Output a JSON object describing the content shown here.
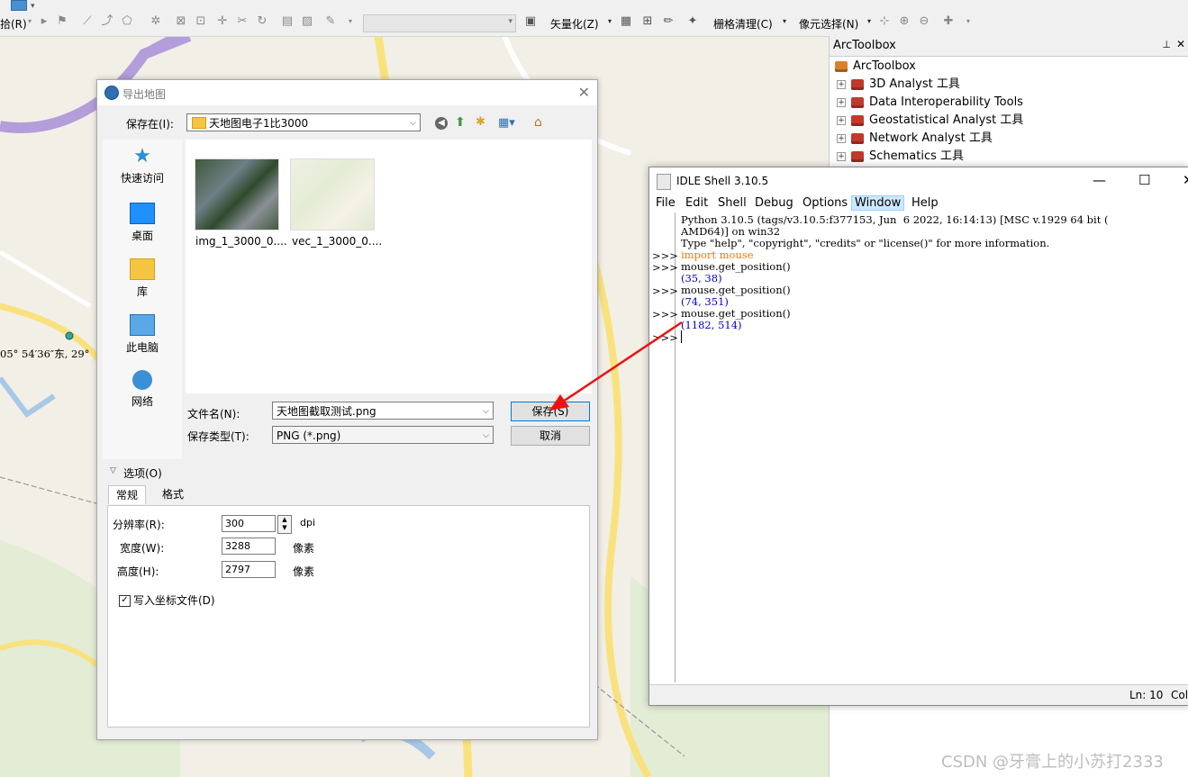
{
  "toolbar": {
    "fragment_left": "拾(R)",
    "vectorize_label": "矢量化(Z)",
    "raster_clean_label": "栅格清理(C)",
    "pixel_select_label": "像元选择(N)"
  },
  "map": {
    "coordinate_text": "05° 54′36″东, 29°"
  },
  "arctoolbox": {
    "title": "ArcToolbox",
    "root": "ArcToolbox",
    "items": [
      {
        "label": "3D Analyst 工具"
      },
      {
        "label": "Data Interoperability Tools"
      },
      {
        "label": "Geostatistical Analyst 工具"
      },
      {
        "label": "Network Analyst 工具"
      },
      {
        "label": "Schematics 工具"
      }
    ]
  },
  "export_dialog": {
    "title": "导出地图",
    "save_in_label": "保存在(I):",
    "save_in_value": "天地图电子1比3000",
    "places": [
      {
        "label": "快速访问",
        "icon": "star-icon"
      },
      {
        "label": "桌面",
        "icon": "desktop-icon"
      },
      {
        "label": "库",
        "icon": "library-icon"
      },
      {
        "label": "此电脑",
        "icon": "computer-icon"
      },
      {
        "label": "网络",
        "icon": "network-icon"
      }
    ],
    "files": [
      {
        "name": "img_1_3000_0...."
      },
      {
        "name": "vec_1_3000_0...."
      }
    ],
    "filename_label": "文件名(N):",
    "filename_value": "天地图截取测试.png",
    "filetype_label": "保存类型(T):",
    "filetype_value": "PNG (*.png)",
    "save_button": "保存(S)",
    "cancel_button": "取消",
    "options_label": "选项(O)",
    "tabs": [
      "常规",
      "格式"
    ],
    "resolution_label": "分辨率(R):",
    "resolution_value": "300",
    "resolution_unit": "dpi",
    "width_label": "宽度(W):",
    "width_value": "3288",
    "width_unit": "像素",
    "height_label": "高度(H):",
    "height_value": "2797",
    "height_unit": "像素",
    "world_file_label": "写入坐标文件(D)",
    "world_file_checked": true
  },
  "idle": {
    "title": "IDLE Shell 3.10.5",
    "menus": [
      "File",
      "Edit",
      "Shell",
      "Debug",
      "Options",
      "Window",
      "Help"
    ],
    "active_menu": "Window",
    "lines": [
      {
        "prompt": "",
        "text": "Python 3.10.5 (tags/v3.10.5:f377153, Jun  6 2022, 16:14:13) [MSC v.1929 64 bit (",
        "style": "plain"
      },
      {
        "prompt": "",
        "text": "AMD64)] on win32",
        "style": "plain"
      },
      {
        "prompt": "",
        "text": "Type \"help\", \"copyright\", \"credits\" or \"license()\" for more information.",
        "style": "plain"
      },
      {
        "prompt": ">>>",
        "text": "import mouse",
        "style": "import"
      },
      {
        "prompt": ">>>",
        "text": "mouse.get_position()",
        "style": "plain"
      },
      {
        "prompt": "",
        "text": "(35, 38)",
        "style": "out"
      },
      {
        "prompt": ">>>",
        "text": "mouse.get_position()",
        "style": "plain"
      },
      {
        "prompt": "",
        "text": "(74, 351)",
        "style": "out"
      },
      {
        "prompt": ">>>",
        "text": "mouse.get_position()",
        "style": "plain"
      },
      {
        "prompt": "",
        "text": "(1182, 514)",
        "style": "out"
      },
      {
        "prompt": ">>>",
        "text": "",
        "style": "plain"
      }
    ],
    "status_ln": "Ln: 10",
    "status_col": "Col"
  },
  "watermark": "CSDN @牙膏上的小苏打2333",
  "colors": {
    "arrow": "#ee1111",
    "map_road": "#f9e27e",
    "map_highway": "#b39ddb",
    "map_water": "#a8c8e8"
  }
}
